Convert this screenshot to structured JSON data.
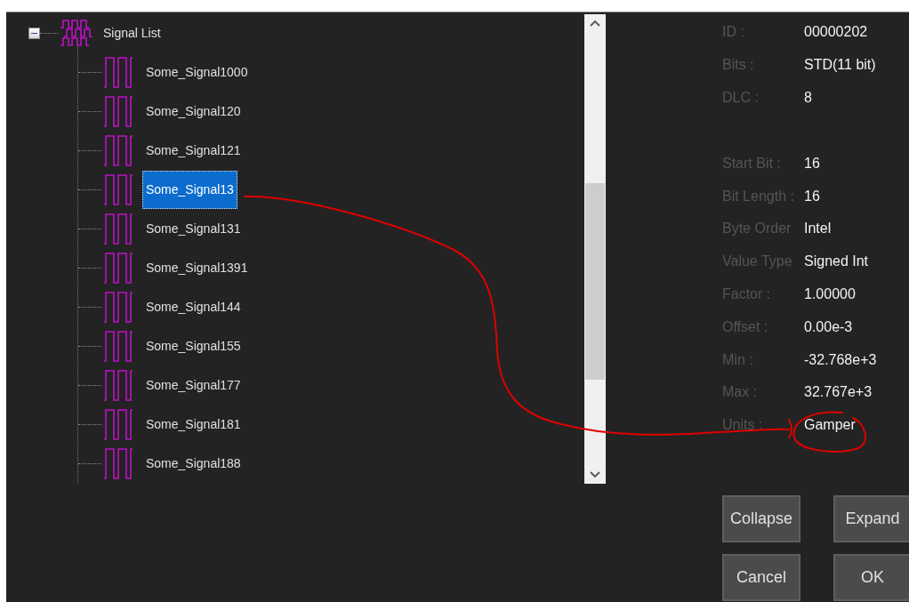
{
  "tree": {
    "label": "Signal List",
    "expanded": true,
    "children": [
      {
        "label": "Some_Signal1000",
        "selected": false
      },
      {
        "label": "Some_Signal120",
        "selected": false
      },
      {
        "label": "Some_Signal121",
        "selected": false
      },
      {
        "label": "Some_Signal13",
        "selected": true
      },
      {
        "label": "Some_Signal131",
        "selected": false
      },
      {
        "label": "Some_Signal1391",
        "selected": false
      },
      {
        "label": "Some_Signal144",
        "selected": false
      },
      {
        "label": "Some_Signal155",
        "selected": false
      },
      {
        "label": "Some_Signal177",
        "selected": false
      },
      {
        "label": "Some_Signal181",
        "selected": false
      },
      {
        "label": "Some_Signal188",
        "selected": false
      }
    ]
  },
  "message_properties": [
    {
      "label": "ID :",
      "value": "00000202"
    },
    {
      "label": "Bits :",
      "value": "STD(11 bit)"
    },
    {
      "label": "DLC :",
      "value": "8"
    }
  ],
  "signal_properties": [
    {
      "label": "Start Bit :",
      "value": "16"
    },
    {
      "label": "Bit Length :",
      "value": "16"
    },
    {
      "label": "Byte Order",
      "value": "Intel"
    },
    {
      "label": "Value Type",
      "value": "Signed Int"
    },
    {
      "label": "Factor :",
      "value": "1.00000"
    },
    {
      "label": "Offset :",
      "value": "0.00e-3"
    },
    {
      "label": "Min :",
      "value": "-32.768e+3"
    },
    {
      "label": "Max :",
      "value": "32.767e+3"
    },
    {
      "label": "Units :",
      "value": "Gamper"
    }
  ],
  "buttons": [
    "Collapse",
    "Expand",
    "Cancel",
    "OK"
  ],
  "annotation": {
    "kind": "freehand-arrow"
  }
}
